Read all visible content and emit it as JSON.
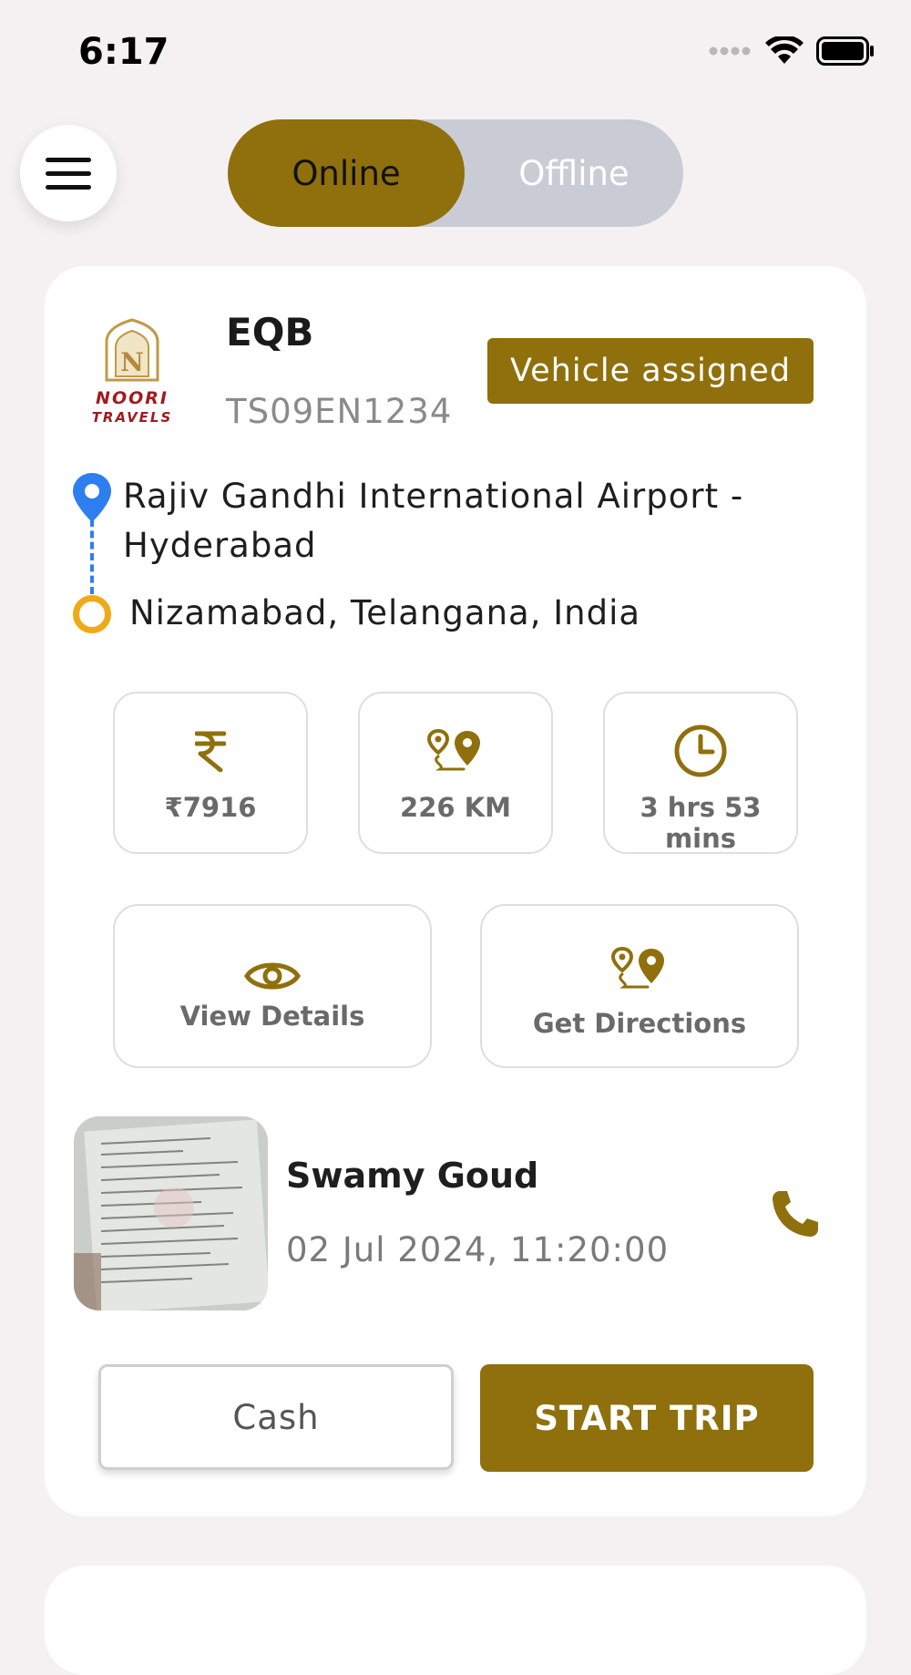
{
  "status_bar": {
    "time": "6:17"
  },
  "header": {
    "menu_icon": "hamburger-menu-icon",
    "toggle": {
      "online_label": "Online",
      "offline_label": "Offline",
      "selected": "Online"
    }
  },
  "trip_card": {
    "logo": {
      "line1": "NOORI",
      "line2": "TRAVELS"
    },
    "vehicle_name": "EQB",
    "plate_number": "TS09EN1234",
    "status_badge": "Vehicle assigned",
    "pickup": "Rajiv Gandhi International Airport - Hyderabad",
    "drop": "Nizamabad, Telangana, India",
    "stats": {
      "fare": {
        "icon": "rupee-icon",
        "value": "₹7916"
      },
      "distance": {
        "icon": "route-pins-icon",
        "value": "226 KM"
      },
      "duration": {
        "icon": "clock-icon",
        "value": "3 hrs 53 mins"
      }
    },
    "actions": {
      "view_details": {
        "icon": "eye-icon",
        "label": "View Details"
      },
      "get_directions": {
        "icon": "route-pins-icon",
        "label": "Get Directions"
      }
    },
    "customer": {
      "name": "Swamy Goud",
      "datetime": "02 Jul 2024, 11:20:00",
      "call_icon": "phone-icon"
    },
    "payment_label": "Cash",
    "start_trip_label": "START TRIP"
  },
  "colors": {
    "accent": "#8f700c",
    "background": "#f5f1f2",
    "pickup_pin": "#2d7ff0",
    "drop_ring": "#efaa17",
    "toggle_off_bg": "#c9ccd4"
  }
}
